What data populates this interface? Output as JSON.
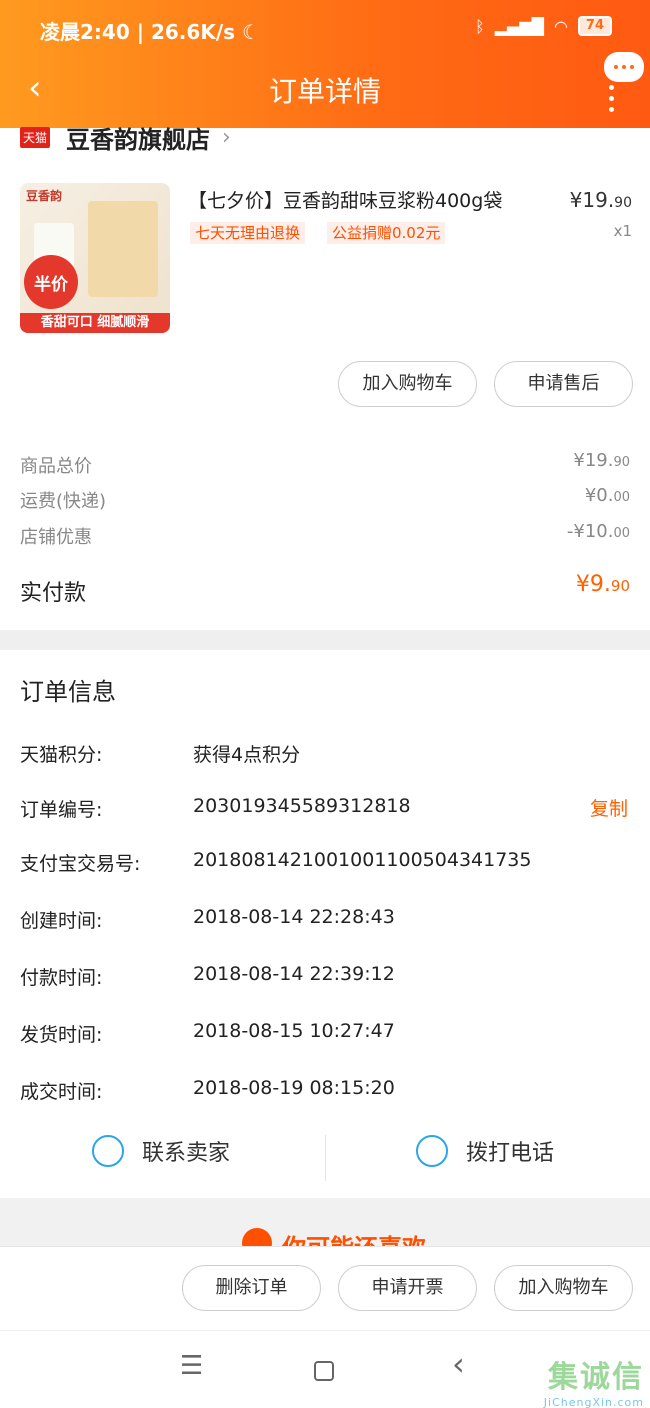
{
  "status_bar": {
    "time_speed": "凌晨2:40 | 26.6K/s ☾",
    "icons": [
      "bluetooth-icon",
      "signal-icon",
      "wifi-icon"
    ],
    "battery": "74"
  },
  "header": {
    "back_icon": "‹",
    "title": "订单详情"
  },
  "store": {
    "tmall_badge": "天猫",
    "name": "豆香韵旗舰店",
    "chevron": "›"
  },
  "product": {
    "image_logo": "豆香韵",
    "image_badge": "半价",
    "image_strip": "香甜可口 细腻顺滑",
    "title": "【七夕价】豆香韵甜味豆浆粉400g袋",
    "tags": [
      "七天无理由退换",
      "公益捐赠0.02元"
    ],
    "price_main": "¥19.",
    "price_cents": "90",
    "quantity": "x1"
  },
  "product_actions": {
    "add_to_cart": "加入购物车",
    "after_sales": "申请售后"
  },
  "summary": {
    "rows": [
      {
        "label": "商品总价",
        "value_main": "¥19.",
        "value_cents": "90"
      },
      {
        "label": "运费(快递)",
        "value_main": "¥0.",
        "value_cents": "00"
      },
      {
        "label": "店铺优惠",
        "value_main": "-¥10.",
        "value_cents": "00"
      }
    ],
    "paid_label": "实付款",
    "paid_main": "¥9.",
    "paid_cents": "90"
  },
  "order_info": {
    "title": "订单信息",
    "copy_label": "复制",
    "rows": [
      {
        "label": "天猫积分:",
        "value": "获得4点积分"
      },
      {
        "label": "订单编号:",
        "value": "203019345589312818"
      },
      {
        "label": "支付宝交易号:",
        "value": "2018081421001001100504341735"
      },
      {
        "label": "创建时间:",
        "value": "2018-08-14 22:28:43"
      },
      {
        "label": "付款时间:",
        "value": "2018-08-14 22:39:12"
      },
      {
        "label": "发货时间:",
        "value": "2018-08-15 10:27:47"
      },
      {
        "label": "成交时间:",
        "value": "2018-08-19 08:15:20"
      }
    ]
  },
  "contact": {
    "seller": "联系卖家",
    "call": "拨打电话"
  },
  "recommend": {
    "title": "你可能还喜欢"
  },
  "bottom_actions": {
    "delete": "删除订单",
    "invoice": "申请开票",
    "add_to_cart": "加入购物车"
  },
  "nav": {
    "menu": "☰",
    "back": "‹"
  },
  "watermark": {
    "main": "集诚信",
    "sub": "JiChengXin.com"
  },
  "colors": {
    "accent": "#ff6000",
    "header_start": "#ff9a1f",
    "header_end": "#ff5a12"
  }
}
